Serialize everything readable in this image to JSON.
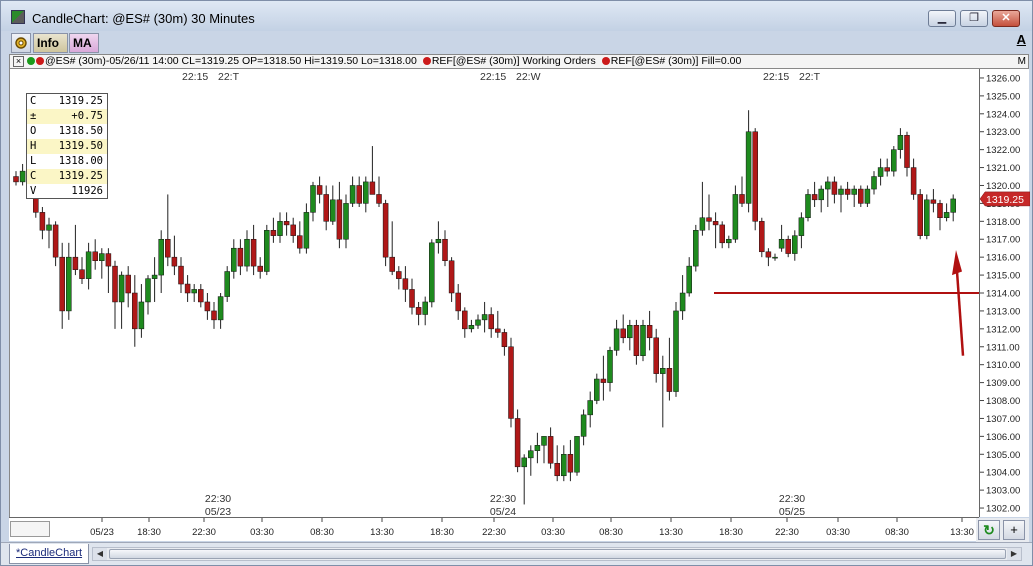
{
  "window": {
    "title": "CandleChart: @ES# (30m) 30 Minutes",
    "buttons": {
      "minimize": "▁",
      "maximize": "❐",
      "close": "✕"
    }
  },
  "toolbar": {
    "info_label": "Info",
    "ma_label": "MA",
    "gear_icon": "gear-icon",
    "a_label": "A"
  },
  "legend": {
    "close_label": "×",
    "series": "@ES# (30m)-05/26/11 14:00 CL=1319.25 OP=1318.50 Hi=1319.50 Lo=1318.00",
    "ref1": "REF[@ES# (30m)] Working Orders",
    "ref2": "REF[@ES# (30m)] Fill=0.00",
    "m_label": "M"
  },
  "ohlc": {
    "rows": [
      {
        "k": "C",
        "v": "1319.25"
      },
      {
        "k": "±",
        "v": "+0.75"
      },
      {
        "k": "O",
        "v": "1318.50"
      },
      {
        "k": "H",
        "v": "1319.50"
      },
      {
        "k": "L",
        "v": "1318.00"
      },
      {
        "k": "C",
        "v": "1319.25"
      },
      {
        "k": "V",
        "v": "11926"
      }
    ]
  },
  "last_price_label": "1319.25",
  "tabs": {
    "active": "*CandleChart"
  },
  "corner": {
    "refresh": "↻",
    "plus": "+"
  },
  "colors": {
    "up": "#1e8a1e",
    "down": "#b01818",
    "wick": "#222222",
    "arrow": "#b01010",
    "price_flag": "#c62828"
  },
  "chart_data": {
    "type": "candlestick",
    "symbol": "@ES# (30m)",
    "ylim": [
      1301.5,
      1326.5
    ],
    "y_ticks": [
      "1302.00",
      "1303.00",
      "1304.00",
      "1305.00",
      "1306.00",
      "1307.00",
      "1308.00",
      "1309.00",
      "1310.00",
      "1311.00",
      "1312.00",
      "1313.00",
      "1314.00",
      "1315.00",
      "1316.00",
      "1317.00",
      "1318.00",
      "1319.00",
      "1320.00",
      "1321.00",
      "1322.00",
      "1323.00",
      "1324.00",
      "1325.00",
      "1326.00"
    ],
    "x_ticks": [
      "05/23",
      "18:30",
      "22:30",
      "03:30",
      "08:30",
      "13:30",
      "18:30",
      "22:30",
      "03:30",
      "08:30",
      "13:30",
      "18:30",
      "22:30",
      "03:30",
      "08:30",
      "13:30"
    ],
    "session_top_labels": [
      {
        "time": "22:15",
        "day": "22:T"
      },
      {
        "time": "22:15",
        "day": "22:W"
      },
      {
        "time": "22:15",
        "day": "22:T"
      }
    ],
    "session_bottom_labels": [
      {
        "time": "22:30",
        "date": "05/23"
      },
      {
        "time": "22:30",
        "date": "05/24"
      },
      {
        "time": "22:30",
        "date": "05/25"
      }
    ],
    "horizontal_line": 1314.0,
    "candles": [
      [
        1320.5,
        1320.8,
        1320.0,
        1320.2
      ],
      [
        1320.2,
        1321.2,
        1320.0,
        1320.8
      ],
      [
        1320.8,
        1321.0,
        1319.5,
        1319.8
      ],
      [
        1319.8,
        1320.0,
        1318.2,
        1318.5
      ],
      [
        1318.5,
        1318.8,
        1317.0,
        1317.5
      ],
      [
        1317.5,
        1318.2,
        1316.5,
        1317.8
      ],
      [
        1317.8,
        1318.0,
        1315.5,
        1316.0
      ],
      [
        1316.0,
        1316.8,
        1312.0,
        1313.0
      ],
      [
        1313.0,
        1316.8,
        1312.5,
        1316.0
      ],
      [
        1316.0,
        1317.8,
        1315.0,
        1315.3
      ],
      [
        1315.3,
        1316.0,
        1314.5,
        1314.8
      ],
      [
        1314.8,
        1316.8,
        1314.2,
        1316.3
      ],
      [
        1316.3,
        1317.0,
        1315.3,
        1315.8
      ],
      [
        1315.8,
        1316.5,
        1314.8,
        1316.2
      ],
      [
        1316.2,
        1316.5,
        1314.0,
        1315.5
      ],
      [
        1315.5,
        1315.8,
        1312.0,
        1313.5
      ],
      [
        1313.5,
        1315.2,
        1312.0,
        1315.0
      ],
      [
        1315.0,
        1315.5,
        1313.2,
        1314.0
      ],
      [
        1314.0,
        1315.0,
        1311.0,
        1312.0
      ],
      [
        1312.0,
        1314.5,
        1311.5,
        1313.5
      ],
      [
        1313.5,
        1315.0,
        1312.8,
        1314.8
      ],
      [
        1314.8,
        1316.0,
        1313.5,
        1315.0
      ],
      [
        1315.0,
        1317.5,
        1314.0,
        1317.0
      ],
      [
        1317.0,
        1319.5,
        1315.5,
        1316.0
      ],
      [
        1316.0,
        1317.2,
        1315.0,
        1315.5
      ],
      [
        1315.5,
        1316.0,
        1314.0,
        1314.5
      ],
      [
        1314.5,
        1315.0,
        1313.5,
        1314.0
      ],
      [
        1314.0,
        1314.5,
        1313.5,
        1314.2
      ],
      [
        1314.2,
        1314.5,
        1313.2,
        1313.5
      ],
      [
        1313.5,
        1314.0,
        1312.5,
        1313.0
      ],
      [
        1313.0,
        1313.5,
        1312.0,
        1312.5
      ],
      [
        1312.5,
        1314.0,
        1312.0,
        1313.8
      ],
      [
        1313.8,
        1315.5,
        1313.5,
        1315.2
      ],
      [
        1315.2,
        1317.0,
        1314.8,
        1316.5
      ],
      [
        1316.5,
        1317.0,
        1315.0,
        1315.5
      ],
      [
        1315.5,
        1317.5,
        1315.2,
        1317.0
      ],
      [
        1317.0,
        1317.8,
        1315.0,
        1315.5
      ],
      [
        1315.5,
        1316.0,
        1314.8,
        1315.2
      ],
      [
        1315.2,
        1317.8,
        1315.0,
        1317.5
      ],
      [
        1317.5,
        1318.2,
        1316.8,
        1317.2
      ],
      [
        1317.2,
        1318.5,
        1316.8,
        1318.0
      ],
      [
        1318.0,
        1318.5,
        1317.2,
        1317.8
      ],
      [
        1317.8,
        1318.2,
        1316.8,
        1317.2
      ],
      [
        1317.2,
        1318.0,
        1316.2,
        1316.5
      ],
      [
        1316.5,
        1319.0,
        1316.2,
        1318.5
      ],
      [
        1318.5,
        1320.2,
        1318.0,
        1320.0
      ],
      [
        1320.0,
        1320.5,
        1319.0,
        1319.5
      ],
      [
        1319.5,
        1320.0,
        1317.5,
        1318.0
      ],
      [
        1318.0,
        1320.0,
        1317.8,
        1319.2
      ],
      [
        1319.2,
        1320.2,
        1316.5,
        1317.0
      ],
      [
        1317.0,
        1319.5,
        1316.5,
        1319.0
      ],
      [
        1319.0,
        1320.5,
        1318.8,
        1320.0
      ],
      [
        1320.0,
        1320.5,
        1318.8,
        1319.0
      ],
      [
        1319.0,
        1320.5,
        1318.5,
        1320.2
      ],
      [
        1320.2,
        1322.2,
        1319.8,
        1319.5
      ],
      [
        1319.5,
        1320.5,
        1318.8,
        1319.0
      ],
      [
        1319.0,
        1319.2,
        1315.5,
        1316.0
      ],
      [
        1316.0,
        1318.0,
        1315.0,
        1315.2
      ],
      [
        1315.2,
        1315.5,
        1314.2,
        1314.8
      ],
      [
        1314.8,
        1315.5,
        1313.5,
        1314.2
      ],
      [
        1314.2,
        1314.8,
        1312.8,
        1313.2
      ],
      [
        1313.2,
        1313.5,
        1312.2,
        1312.8
      ],
      [
        1312.8,
        1313.8,
        1312.2,
        1313.5
      ],
      [
        1313.5,
        1317.0,
        1313.2,
        1316.8
      ],
      [
        1316.8,
        1318.0,
        1316.2,
        1317.0
      ],
      [
        1317.0,
        1317.5,
        1315.5,
        1315.8
      ],
      [
        1315.8,
        1316.0,
        1313.5,
        1314.0
      ],
      [
        1314.0,
        1314.5,
        1312.5,
        1313.0
      ],
      [
        1313.0,
        1313.2,
        1311.5,
        1312.0
      ],
      [
        1312.0,
        1312.5,
        1311.8,
        1312.2
      ],
      [
        1312.2,
        1312.8,
        1312.0,
        1312.5
      ],
      [
        1312.5,
        1313.5,
        1311.8,
        1312.8
      ],
      [
        1312.8,
        1313.2,
        1311.5,
        1312.0
      ],
      [
        1312.0,
        1313.0,
        1311.5,
        1311.8
      ],
      [
        1311.8,
        1312.0,
        1310.5,
        1311.0
      ],
      [
        1311.0,
        1311.5,
        1306.5,
        1307.0
      ],
      [
        1307.0,
        1307.5,
        1304.0,
        1304.3
      ],
      [
        1304.3,
        1305.0,
        1302.2,
        1304.8
      ],
      [
        1304.8,
        1305.5,
        1303.8,
        1305.2
      ],
      [
        1305.2,
        1306.2,
        1304.5,
        1305.5
      ],
      [
        1305.5,
        1306.0,
        1304.5,
        1306.0
      ],
      [
        1306.0,
        1306.5,
        1304.2,
        1304.5
      ],
      [
        1304.5,
        1305.5,
        1303.5,
        1303.8
      ],
      [
        1303.8,
        1305.5,
        1303.5,
        1305.0
      ],
      [
        1305.0,
        1305.8,
        1303.5,
        1304.0
      ],
      [
        1304.0,
        1306.0,
        1303.8,
        1306.0
      ],
      [
        1306.0,
        1307.5,
        1305.5,
        1307.2
      ],
      [
        1307.2,
        1308.5,
        1306.5,
        1308.0
      ],
      [
        1308.0,
        1309.5,
        1307.8,
        1309.2
      ],
      [
        1309.2,
        1310.5,
        1308.0,
        1309.0
      ],
      [
        1309.0,
        1311.0,
        1308.5,
        1310.8
      ],
      [
        1310.8,
        1312.5,
        1310.5,
        1312.0
      ],
      [
        1312.0,
        1312.8,
        1311.2,
        1311.5
      ],
      [
        1311.5,
        1312.5,
        1310.8,
        1312.2
      ],
      [
        1312.2,
        1312.5,
        1310.0,
        1310.5
      ],
      [
        1310.5,
        1312.5,
        1310.2,
        1312.2
      ],
      [
        1312.2,
        1313.0,
        1310.8,
        1311.5
      ],
      [
        1311.5,
        1312.0,
        1309.0,
        1309.5
      ],
      [
        1309.5,
        1310.5,
        1306.5,
        1309.8
      ],
      [
        1309.8,
        1311.5,
        1308.0,
        1308.5
      ],
      [
        1308.5,
        1313.5,
        1308.2,
        1313.0
      ],
      [
        1313.0,
        1315.0,
        1312.5,
        1314.0
      ],
      [
        1314.0,
        1316.0,
        1313.8,
        1315.5
      ],
      [
        1315.5,
        1317.8,
        1315.2,
        1317.5
      ],
      [
        1317.5,
        1320.2,
        1317.2,
        1318.2
      ],
      [
        1318.2,
        1319.5,
        1317.5,
        1318.0
      ],
      [
        1318.0,
        1318.5,
        1316.5,
        1317.8
      ],
      [
        1317.8,
        1318.0,
        1316.5,
        1316.8
      ],
      [
        1316.8,
        1317.2,
        1316.5,
        1317.0
      ],
      [
        1317.0,
        1320.0,
        1316.8,
        1319.5
      ],
      [
        1319.5,
        1320.5,
        1318.8,
        1319.0
      ],
      [
        1319.0,
        1324.2,
        1318.5,
        1323.0
      ],
      [
        1323.0,
        1323.2,
        1317.5,
        1318.0
      ],
      [
        1318.0,
        1318.2,
        1316.0,
        1316.3
      ],
      [
        1316.3,
        1316.5,
        1315.5,
        1316.0
      ],
      [
        1316.0,
        1316.2,
        1315.8,
        1316.0
      ],
      [
        1316.5,
        1317.8,
        1316.3,
        1317.0
      ],
      [
        1317.0,
        1317.2,
        1316.0,
        1316.2
      ],
      [
        1316.2,
        1317.5,
        1315.8,
        1317.2
      ],
      [
        1317.2,
        1318.5,
        1316.5,
        1318.2
      ],
      [
        1318.2,
        1319.8,
        1318.0,
        1319.5
      ],
      [
        1319.5,
        1320.2,
        1318.8,
        1319.2
      ],
      [
        1319.2,
        1320.0,
        1318.5,
        1319.8
      ],
      [
        1319.8,
        1320.5,
        1318.8,
        1320.2
      ],
      [
        1320.2,
        1320.5,
        1319.0,
        1319.5
      ],
      [
        1319.5,
        1320.0,
        1318.5,
        1319.8
      ],
      [
        1319.8,
        1320.2,
        1319.2,
        1319.5
      ],
      [
        1319.5,
        1320.0,
        1318.8,
        1319.8
      ],
      [
        1319.8,
        1320.0,
        1318.8,
        1319.0
      ],
      [
        1319.0,
        1320.0,
        1318.8,
        1319.8
      ],
      [
        1319.8,
        1320.8,
        1319.5,
        1320.5
      ],
      [
        1320.5,
        1321.5,
        1320.0,
        1321.0
      ],
      [
        1321.0,
        1321.5,
        1320.5,
        1320.8
      ],
      [
        1320.8,
        1322.2,
        1320.5,
        1322.0
      ],
      [
        1322.0,
        1323.2,
        1321.5,
        1322.8
      ],
      [
        1322.8,
        1323.0,
        1320.5,
        1321.0
      ],
      [
        1321.0,
        1321.5,
        1319.2,
        1319.5
      ],
      [
        1319.5,
        1319.8,
        1317.0,
        1317.2
      ],
      [
        1317.2,
        1319.5,
        1317.0,
        1319.2
      ],
      [
        1319.2,
        1319.8,
        1318.5,
        1319.0
      ],
      [
        1319.0,
        1319.2,
        1317.5,
        1318.2
      ],
      [
        1318.2,
        1319.0,
        1318.0,
        1318.5
      ],
      [
        1318.5,
        1319.5,
        1318.0,
        1319.25
      ]
    ]
  }
}
